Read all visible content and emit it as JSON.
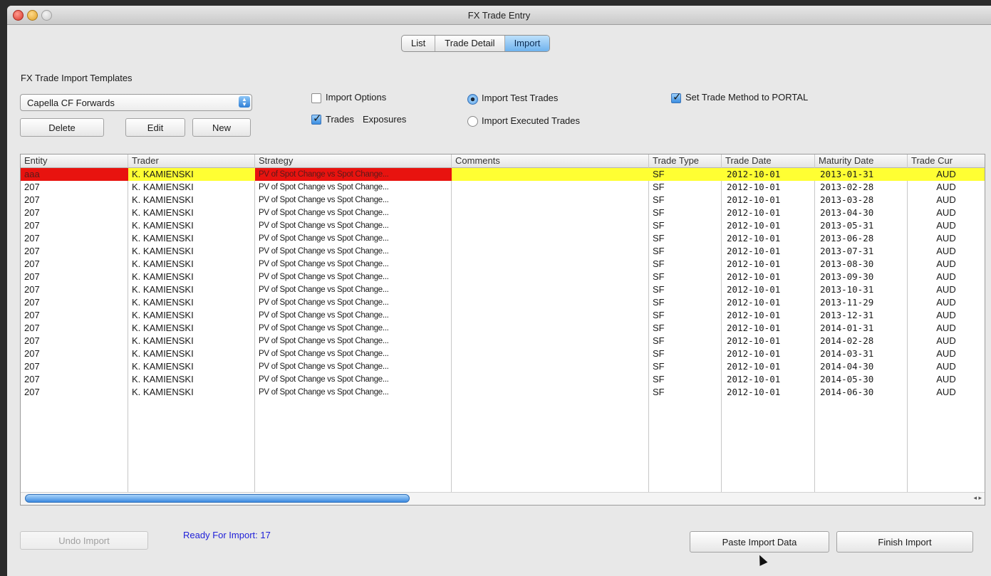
{
  "window": {
    "title": "FX Trade Entry"
  },
  "tabs": [
    {
      "label": "List",
      "active": false
    },
    {
      "label": "Trade Detail",
      "active": false
    },
    {
      "label": "Import",
      "active": true
    }
  ],
  "templates": {
    "label": "FX Trade Import Templates",
    "selected": "Capella CF Forwards",
    "delete_label": "Delete",
    "edit_label": "Edit",
    "new_label": "New"
  },
  "options": {
    "import_options": {
      "label": "Import Options",
      "checked": false
    },
    "trades": {
      "label": "Trades",
      "checked": true
    },
    "exposures": {
      "label": "Exposures"
    },
    "import_test_trades": {
      "label": "Import Test Trades",
      "selected": true
    },
    "import_executed_trades": {
      "label": "Import Executed Trades",
      "selected": false
    },
    "set_trade_method": {
      "label": "Set Trade Method to PORTAL",
      "checked": true
    }
  },
  "table": {
    "columns": [
      "Entity",
      "Trader",
      "Strategy",
      "Comments",
      "Trade Type",
      "Trade Date",
      "Maturity Date",
      "Trade Cur"
    ],
    "rows": [
      [
        "aaa",
        "K. KAMIENSKI",
        "PV of Spot Change vs Spot Change...",
        "",
        "SF",
        "2012-10-01",
        "2013-01-31",
        "AUD"
      ],
      [
        "207",
        "K. KAMIENSKI",
        "PV of Spot Change vs Spot Change...",
        "",
        "SF",
        "2012-10-01",
        "2013-02-28",
        "AUD"
      ],
      [
        "207",
        "K. KAMIENSKI",
        "PV of Spot Change vs Spot Change...",
        "",
        "SF",
        "2012-10-01",
        "2013-03-28",
        "AUD"
      ],
      [
        "207",
        "K. KAMIENSKI",
        "PV of Spot Change vs Spot Change...",
        "",
        "SF",
        "2012-10-01",
        "2013-04-30",
        "AUD"
      ],
      [
        "207",
        "K. KAMIENSKI",
        "PV of Spot Change vs Spot Change...",
        "",
        "SF",
        "2012-10-01",
        "2013-05-31",
        "AUD"
      ],
      [
        "207",
        "K. KAMIENSKI",
        "PV of Spot Change vs Spot Change...",
        "",
        "SF",
        "2012-10-01",
        "2013-06-28",
        "AUD"
      ],
      [
        "207",
        "K. KAMIENSKI",
        "PV of Spot Change vs Spot Change...",
        "",
        "SF",
        "2012-10-01",
        "2013-07-31",
        "AUD"
      ],
      [
        "207",
        "K. KAMIENSKI",
        "PV of Spot Change vs Spot Change...",
        "",
        "SF",
        "2012-10-01",
        "2013-08-30",
        "AUD"
      ],
      [
        "207",
        "K. KAMIENSKI",
        "PV of Spot Change vs Spot Change...",
        "",
        "SF",
        "2012-10-01",
        "2013-09-30",
        "AUD"
      ],
      [
        "207",
        "K. KAMIENSKI",
        "PV of Spot Change vs Spot Change...",
        "",
        "SF",
        "2012-10-01",
        "2013-10-31",
        "AUD"
      ],
      [
        "207",
        "K. KAMIENSKI",
        "PV of Spot Change vs Spot Change...",
        "",
        "SF",
        "2012-10-01",
        "2013-11-29",
        "AUD"
      ],
      [
        "207",
        "K. KAMIENSKI",
        "PV of Spot Change vs Spot Change...",
        "",
        "SF",
        "2012-10-01",
        "2013-12-31",
        "AUD"
      ],
      [
        "207",
        "K. KAMIENSKI",
        "PV of Spot Change vs Spot Change...",
        "",
        "SF",
        "2012-10-01",
        "2014-01-31",
        "AUD"
      ],
      [
        "207",
        "K. KAMIENSKI",
        "PV of Spot Change vs Spot Change...",
        "",
        "SF",
        "2012-10-01",
        "2014-02-28",
        "AUD"
      ],
      [
        "207",
        "K. KAMIENSKI",
        "PV of Spot Change vs Spot Change...",
        "",
        "SF",
        "2012-10-01",
        "2014-03-31",
        "AUD"
      ],
      [
        "207",
        "K. KAMIENSKI",
        "PV of Spot Change vs Spot Change...",
        "",
        "SF",
        "2012-10-01",
        "2014-04-30",
        "AUD"
      ],
      [
        "207",
        "K. KAMIENSKI",
        "PV of Spot Change vs Spot Change...",
        "",
        "SF",
        "2012-10-01",
        "2014-05-30",
        "AUD"
      ],
      [
        "207",
        "K. KAMIENSKI",
        "PV of Spot Change vs Spot Change...",
        "",
        "SF",
        "2012-10-01",
        "2014-06-30",
        "AUD"
      ]
    ],
    "highlight_color": "#ffff33",
    "error_color": "#e8130f"
  },
  "footer": {
    "undo_label": "Undo Import",
    "status": "Ready For Import: 17",
    "paste_label": "Paste Import Data",
    "finish_label": "Finish Import"
  }
}
